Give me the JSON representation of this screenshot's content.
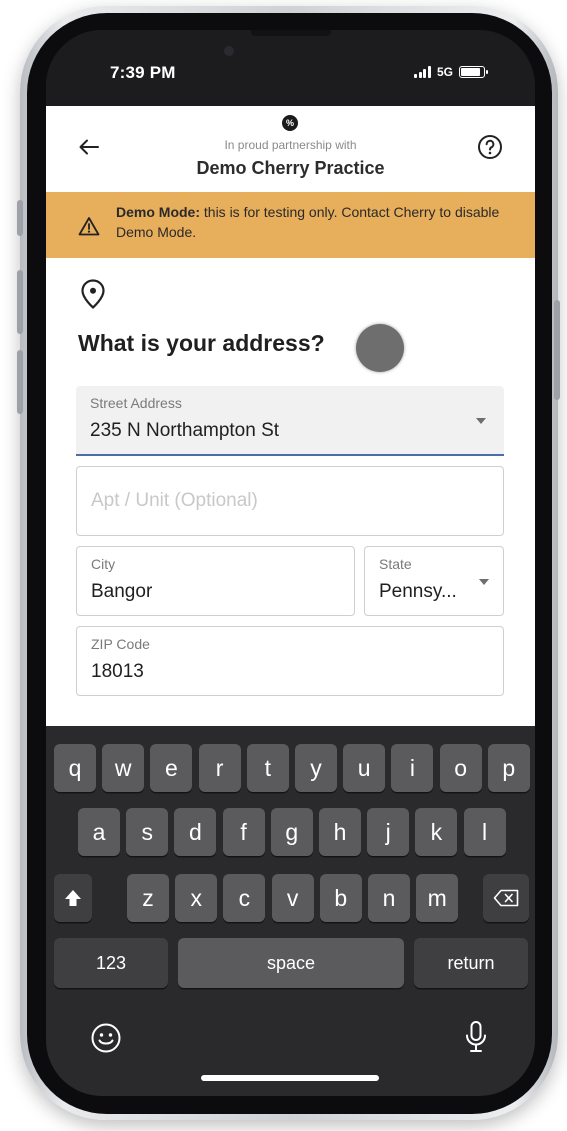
{
  "status_bar": {
    "time": "7:39 PM",
    "network": "5G",
    "battery_level": 0.85
  },
  "header": {
    "logo_glyph": "%",
    "partnership_text": "In proud partnership with",
    "practice_name": "Demo Cherry Practice"
  },
  "demo_banner": {
    "title": "Demo Mode:",
    "message": " this is for testing only. Contact Cherry to disable Demo Mode."
  },
  "form": {
    "question": "What is your address?",
    "street": {
      "label": "Street Address",
      "value": "235 N Northampton St"
    },
    "apt": {
      "placeholder": "Apt / Unit (Optional)"
    },
    "city": {
      "label": "City",
      "value": "Bangor"
    },
    "state": {
      "label": "State",
      "value": "Pennsy..."
    },
    "zip": {
      "label": "ZIP Code",
      "value": "18013"
    }
  },
  "keyboard": {
    "row1": [
      "q",
      "w",
      "e",
      "r",
      "t",
      "y",
      "u",
      "i",
      "o",
      "p"
    ],
    "row2": [
      "a",
      "s",
      "d",
      "f",
      "g",
      "h",
      "j",
      "k",
      "l"
    ],
    "row3": [
      "z",
      "x",
      "c",
      "v",
      "b",
      "n",
      "m"
    ],
    "numbers_label": "123",
    "space_label": "space",
    "return_label": "return"
  },
  "colors": {
    "banner": "#e7ae5b",
    "keyboard_bg": "#2a2a2c",
    "key": "#5b5b5e",
    "field_focus_line": "#4a6fa5"
  }
}
